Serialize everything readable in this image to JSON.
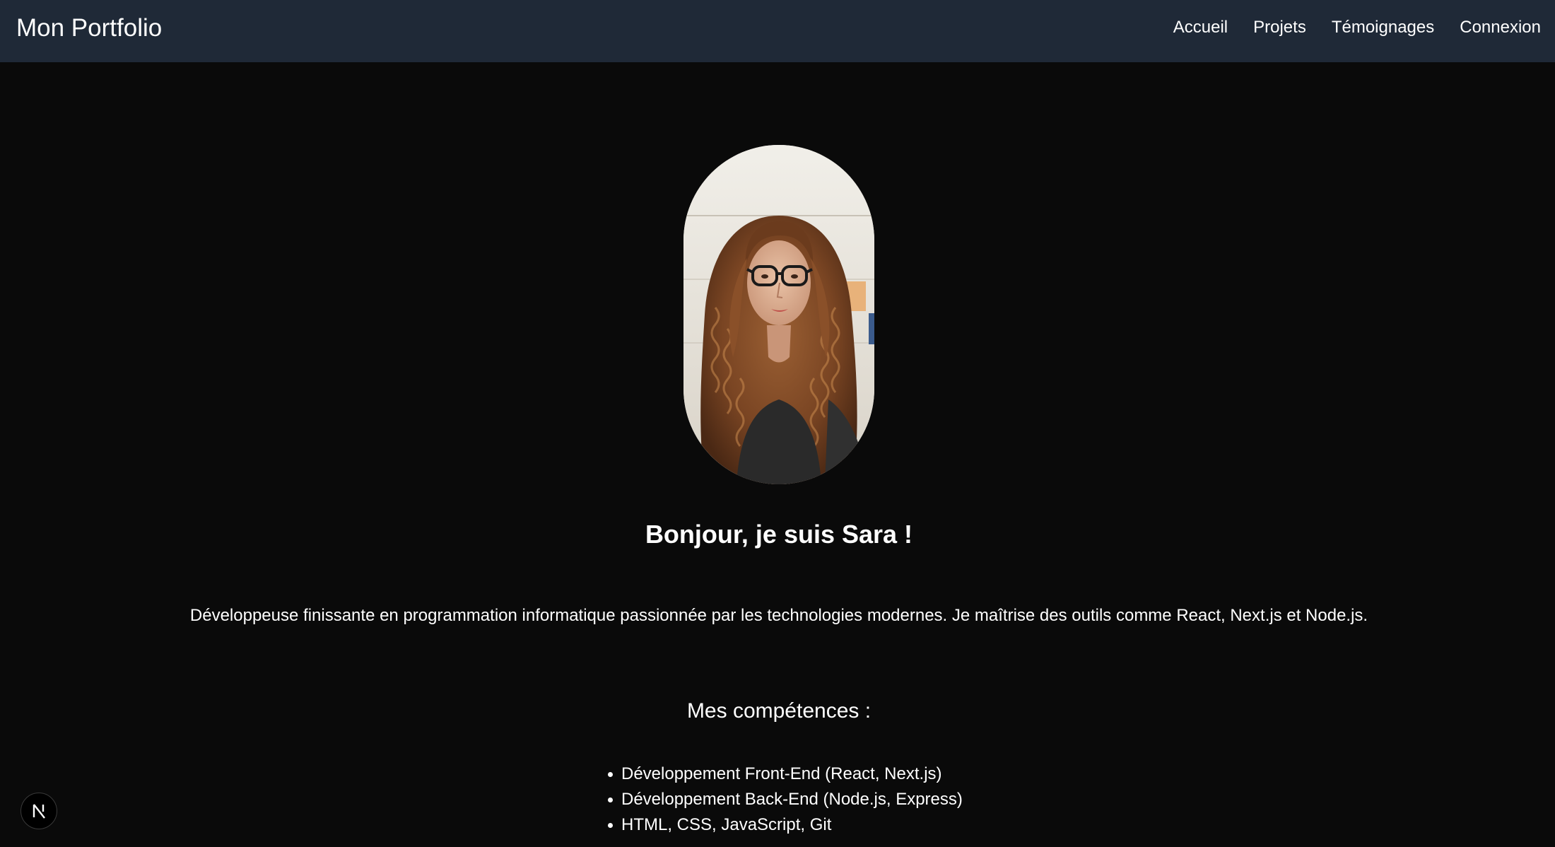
{
  "navbar": {
    "brand": "Mon Portfolio",
    "links": [
      {
        "label": "Accueil"
      },
      {
        "label": "Projets"
      },
      {
        "label": "Témoignages"
      },
      {
        "label": "Connexion"
      }
    ],
    "background": "#1f2937"
  },
  "hero": {
    "headline": "Bonjour, je suis Sara !",
    "intro": "Développeuse finissante en programmation informatique passionnée par les technologies modernes. Je maîtrise des outils comme React, Next.js et Node.js."
  },
  "skills": {
    "title": "Mes compétences :",
    "items": [
      "Développement Front-End (React, Next.js)",
      "Développement Back-End (Node.js, Express)",
      "HTML, CSS, JavaScript, Git"
    ]
  },
  "dev_badge": {
    "icon": "nextjs-logo-icon"
  },
  "colors": {
    "page_background": "#0a0a0a",
    "text": "#ffffff"
  }
}
